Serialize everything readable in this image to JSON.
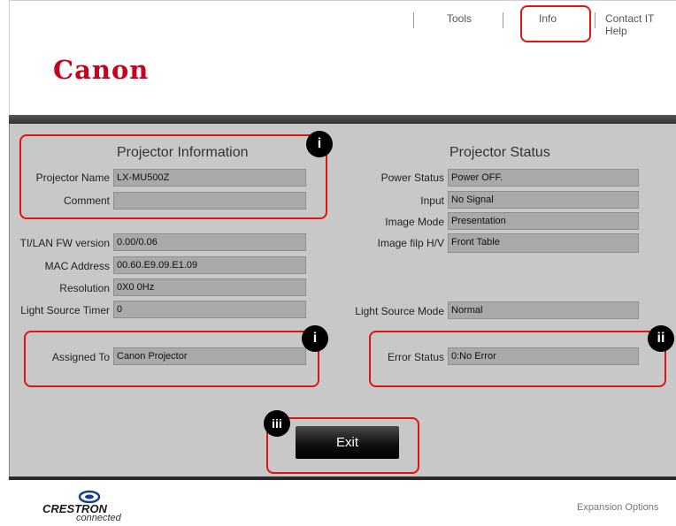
{
  "nav": {
    "tools": "Tools",
    "info": "Info",
    "contact": "Contact IT Help"
  },
  "brand": {
    "logo": "Canon",
    "crestron_line1": "CRESTRON",
    "crestron_line2": "connected"
  },
  "projector_info": {
    "title": "Projector Information",
    "name_label": "Projector Name",
    "name_value": "LX-MU500Z",
    "comment_label": "Comment",
    "comment_value": "",
    "fw_label": "TI/LAN FW version",
    "fw_value": "0.00/0.06",
    "mac_label": "MAC Address",
    "mac_value": "00.60.E9.09.E1.09",
    "res_label": "Resolution",
    "res_value": "0X0 0Hz",
    "timer_label": "Light Source Timer",
    "timer_value": "0",
    "assigned_label": "Assigned To",
    "assigned_value": "Canon Projector"
  },
  "projector_status": {
    "title": "Projector Status",
    "power_label": "Power Status",
    "power_value": "Power OFF.",
    "input_label": "Input",
    "input_value": "No Signal",
    "image_mode_label": "Image Mode",
    "image_mode_value": "Presentation",
    "flip_label": "Image filp H/V",
    "flip_value": "Front Table",
    "light_mode_label": "Light Source Mode",
    "light_mode_value": "Normal",
    "error_label": "Error Status",
    "error_value": "0:No Error"
  },
  "badges": {
    "i": "i",
    "ii": "ii",
    "iii": "iii"
  },
  "actions": {
    "exit": "Exit"
  },
  "footer": {
    "expansion": "Expansion Options"
  },
  "colors": {
    "brand_red": "#c8001e",
    "highlight_red": "#e51212",
    "panel_gray": "#c8c8c8",
    "field_gray": "#a9a9a9"
  }
}
